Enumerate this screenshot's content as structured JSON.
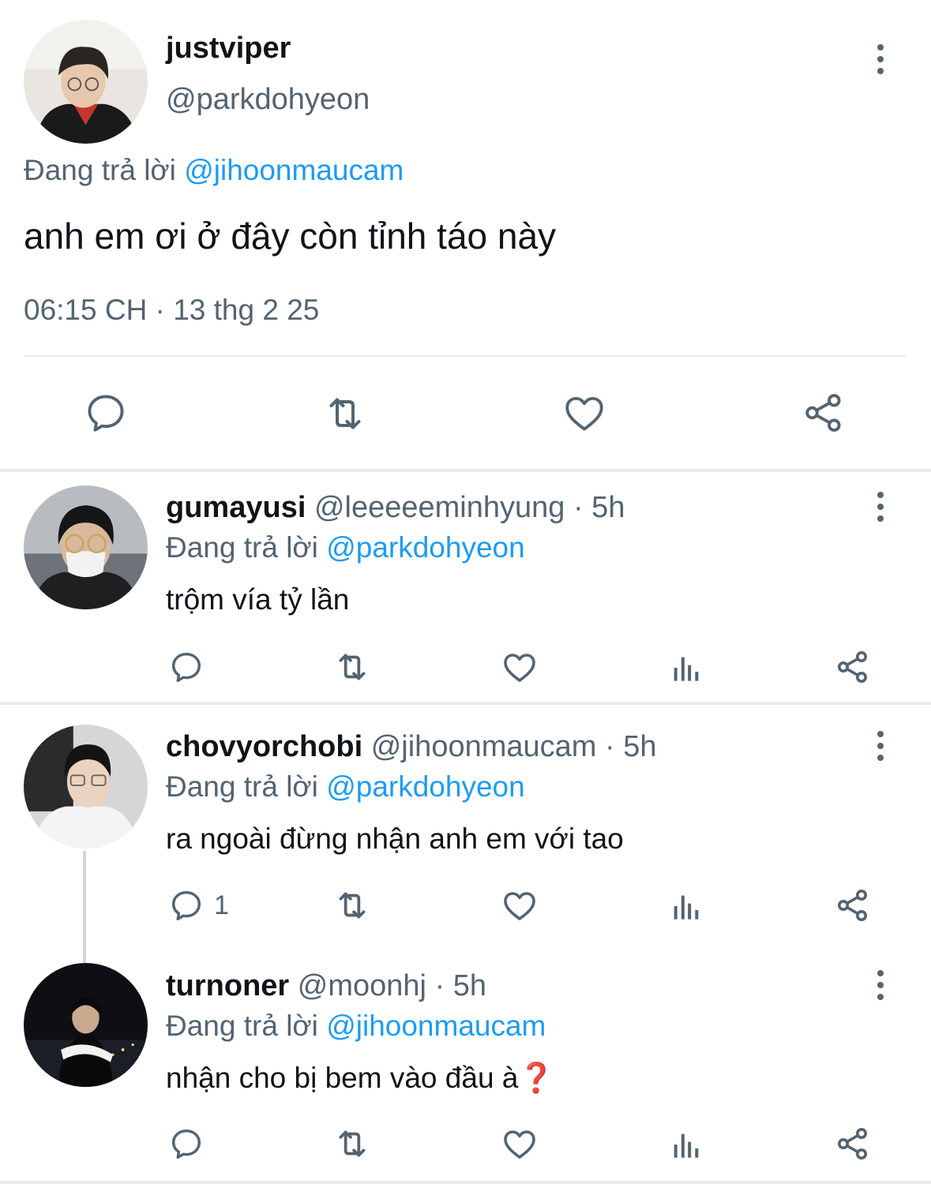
{
  "main_tweet": {
    "display_name": "justviper",
    "handle": "@parkdohyeon",
    "reply_prefix": "Đang trả lời",
    "reply_to": "@jihoonmaucam",
    "text": "anh em ơi ở đây còn tỉnh táo này",
    "timestamp": "06:15 CH · 13 thg 2 25",
    "actions": [
      "reply-icon",
      "retweet-icon",
      "like-icon",
      "share-icon"
    ]
  },
  "replies": [
    {
      "display_name": "gumayusi",
      "handle": "@leeeeeminhyung",
      "time": "· 5h",
      "reply_prefix": "Đang trả lời",
      "reply_to": "@parkdohyeon",
      "text": "trộm vía tỷ lần",
      "reply_count": ""
    },
    {
      "display_name": "chovyorchobi",
      "handle": "@jihoonmaucam",
      "time": "· 5h",
      "reply_prefix": "Đang trả lời",
      "reply_to": "@parkdohyeon",
      "text": "ra ngoài đừng nhận anh em với tao",
      "reply_count": "1"
    },
    {
      "display_name": "turnoner",
      "handle": "@moonhj",
      "time": "· 5h",
      "reply_prefix": "Đang trả lời",
      "reply_to": "@jihoonmaucam",
      "text": "nhận cho bị bem vào đầu à",
      "emoji": "❓",
      "reply_count": ""
    }
  ],
  "colors": {
    "text": "#0f1419",
    "secondary": "#536471",
    "link": "#1d9bf0",
    "divider": "#e6ecf0"
  }
}
